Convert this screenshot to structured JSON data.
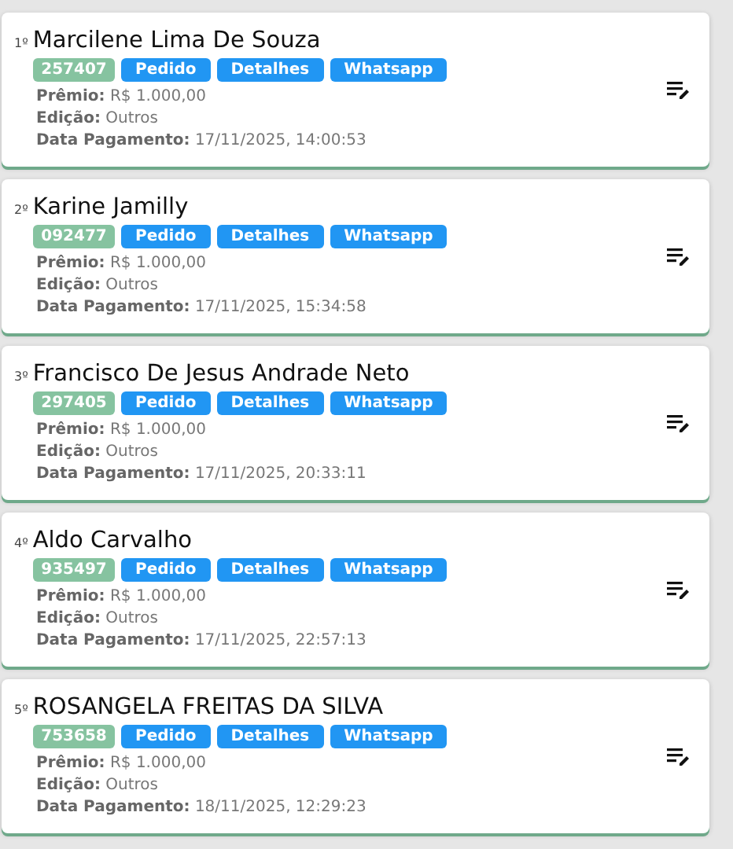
{
  "winners": [
    {
      "rank": "1º",
      "name": "Marcilene Lima De Souza",
      "code": "257407",
      "buttons": [
        "Pedido",
        "Detalhes",
        "Whatsapp"
      ],
      "fields": [
        {
          "label": "Prêmio:",
          "value": "R$ 1.000,00"
        },
        {
          "label": "Edição:",
          "value": "Outros"
        },
        {
          "label": "Data Pagamento:",
          "value": "17/11/2025, 14:00:53"
        }
      ]
    },
    {
      "rank": "2º",
      "name": "Karine Jamilly",
      "code": "092477",
      "buttons": [
        "Pedido",
        "Detalhes",
        "Whatsapp"
      ],
      "fields": [
        {
          "label": "Prêmio:",
          "value": "R$ 1.000,00"
        },
        {
          "label": "Edição:",
          "value": "Outros"
        },
        {
          "label": "Data Pagamento:",
          "value": "17/11/2025, 15:34:58"
        }
      ]
    },
    {
      "rank": "3º",
      "name": "Francisco De Jesus Andrade Neto",
      "code": "297405",
      "buttons": [
        "Pedido",
        "Detalhes",
        "Whatsapp"
      ],
      "fields": [
        {
          "label": "Prêmio:",
          "value": "R$ 1.000,00"
        },
        {
          "label": "Edição:",
          "value": "Outros"
        },
        {
          "label": "Data Pagamento:",
          "value": "17/11/2025, 20:33:11"
        }
      ]
    },
    {
      "rank": "4º",
      "name": "Aldo Carvalho",
      "code": "935497",
      "buttons": [
        "Pedido",
        "Detalhes",
        "Whatsapp"
      ],
      "fields": [
        {
          "label": "Prêmio:",
          "value": "R$ 1.000,00"
        },
        {
          "label": "Edição:",
          "value": "Outros"
        },
        {
          "label": "Data Pagamento:",
          "value": "17/11/2025, 22:57:13"
        }
      ]
    },
    {
      "rank": "5º",
      "name": "ROSANGELA FREITAS DA SILVA",
      "code": "753658",
      "buttons": [
        "Pedido",
        "Detalhes",
        "Whatsapp"
      ],
      "fields": [
        {
          "label": "Prêmio:",
          "value": "R$ 1.000,00"
        },
        {
          "label": "Edição:",
          "value": "Outros"
        },
        {
          "label": "Data Pagamento:",
          "value": "18/11/2025, 12:29:23"
        }
      ]
    }
  ]
}
